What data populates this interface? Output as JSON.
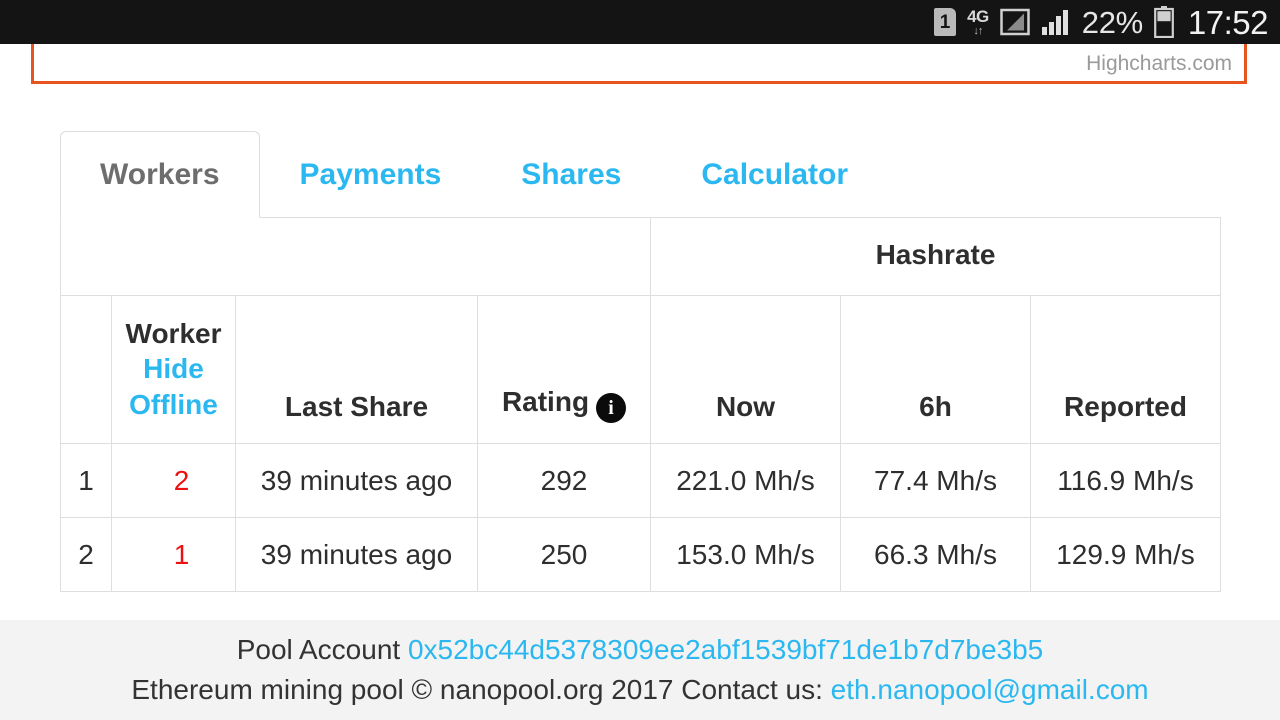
{
  "statusbar": {
    "sim_label": "1",
    "network_type": "4G",
    "network_arrows": "↓↑",
    "battery_percent": "22%",
    "clock": "17:52",
    "icons": [
      "sim-card-icon",
      "network-4g-icon",
      "signal-bars-muted-icon",
      "signal-bars-icon",
      "battery-icon"
    ]
  },
  "chart": {
    "credit": "Highcharts.com",
    "border_color": "#e8541d"
  },
  "tabs": [
    {
      "label": "Workers",
      "active": true
    },
    {
      "label": "Payments",
      "active": false
    },
    {
      "label": "Shares",
      "active": false
    },
    {
      "label": "Calculator",
      "active": false
    }
  ],
  "table": {
    "group_headers": [
      {
        "label": "",
        "span": 4
      },
      {
        "label": "Hashrate",
        "span": 3
      }
    ],
    "columns": [
      "",
      "Worker",
      "Last Share",
      "Rating",
      "Now",
      "6h",
      "Reported"
    ],
    "worker_header": {
      "title": "Worker",
      "hide_offline_line1": "Hide",
      "hide_offline_line2": "Offline"
    },
    "rating_header": {
      "label": "Rating",
      "info_glyph": "i"
    },
    "rows": [
      {
        "index": "1",
        "worker": "2",
        "last_share": "39 minutes ago",
        "rating": "292",
        "now": "221.0 Mh/s",
        "h6": "77.4 Mh/s",
        "reported": "116.9 Mh/s"
      },
      {
        "index": "2",
        "worker": "1",
        "last_share": "39 minutes ago",
        "rating": "250",
        "now": "153.0 Mh/s",
        "h6": "66.3 Mh/s",
        "reported": "129.9 Mh/s"
      }
    ]
  },
  "footer": {
    "pool_account_label": "Pool Account",
    "pool_account_address": "0x52bc44d5378309ee2abf1539bf71de1b7d7be3b5",
    "copyright": "Ethereum mining pool © nanopool.org 2017 Contact us:",
    "contact_email": "eth.nanopool@gmail.com"
  },
  "colors": {
    "link_blue": "#2bb8f0",
    "worker_red": "#ee1111",
    "accent_orange": "#e8541d",
    "footer_bg": "#f3f3f3"
  }
}
